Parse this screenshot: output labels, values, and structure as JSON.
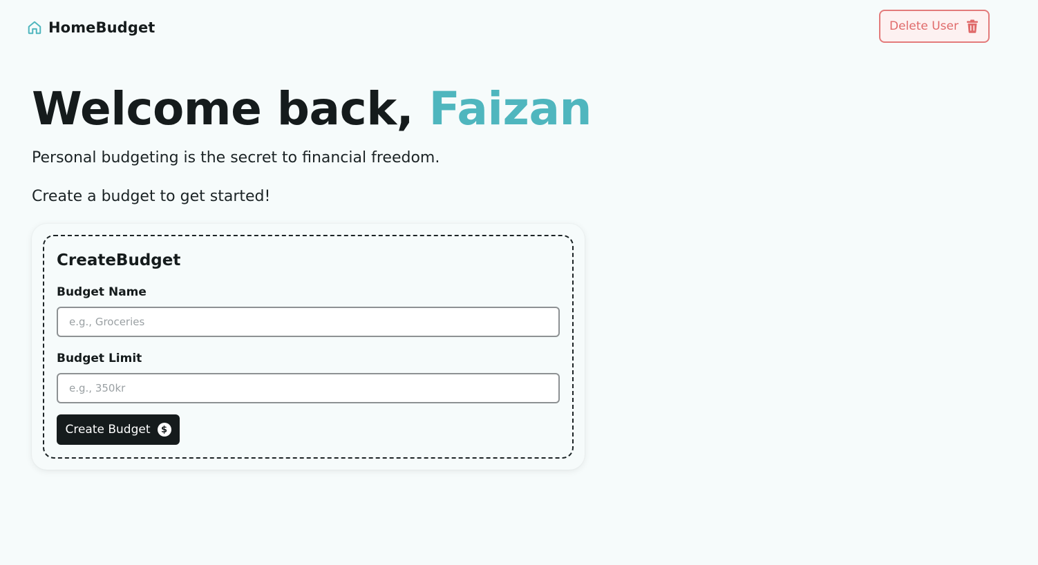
{
  "nav": {
    "brand": "HomeBudget",
    "brand_icon": "home-icon",
    "delete_label": "Delete User",
    "delete_icon": "trash-icon"
  },
  "hero": {
    "greeting": "Welcome back, ",
    "user_name": "Faizan",
    "tagline": "Personal budgeting is the secret to financial freedom.",
    "prompt": "Create a budget to get started!"
  },
  "form": {
    "title": "CreateBudget",
    "name_label": "Budget Name",
    "name_value": "",
    "name_placeholder": "e.g., Groceries",
    "limit_label": "Budget Limit",
    "limit_value": "",
    "limit_placeholder": "e.g., 350kr",
    "submit_label": "Create Budget",
    "submit_icon": "dollar-coin-icon"
  },
  "colors": {
    "background": "#f6fbfb",
    "accent": "#4fb6be",
    "text": "#151b1c",
    "danger": "#e06a6a",
    "danger_bg": "#fdf1f1"
  }
}
